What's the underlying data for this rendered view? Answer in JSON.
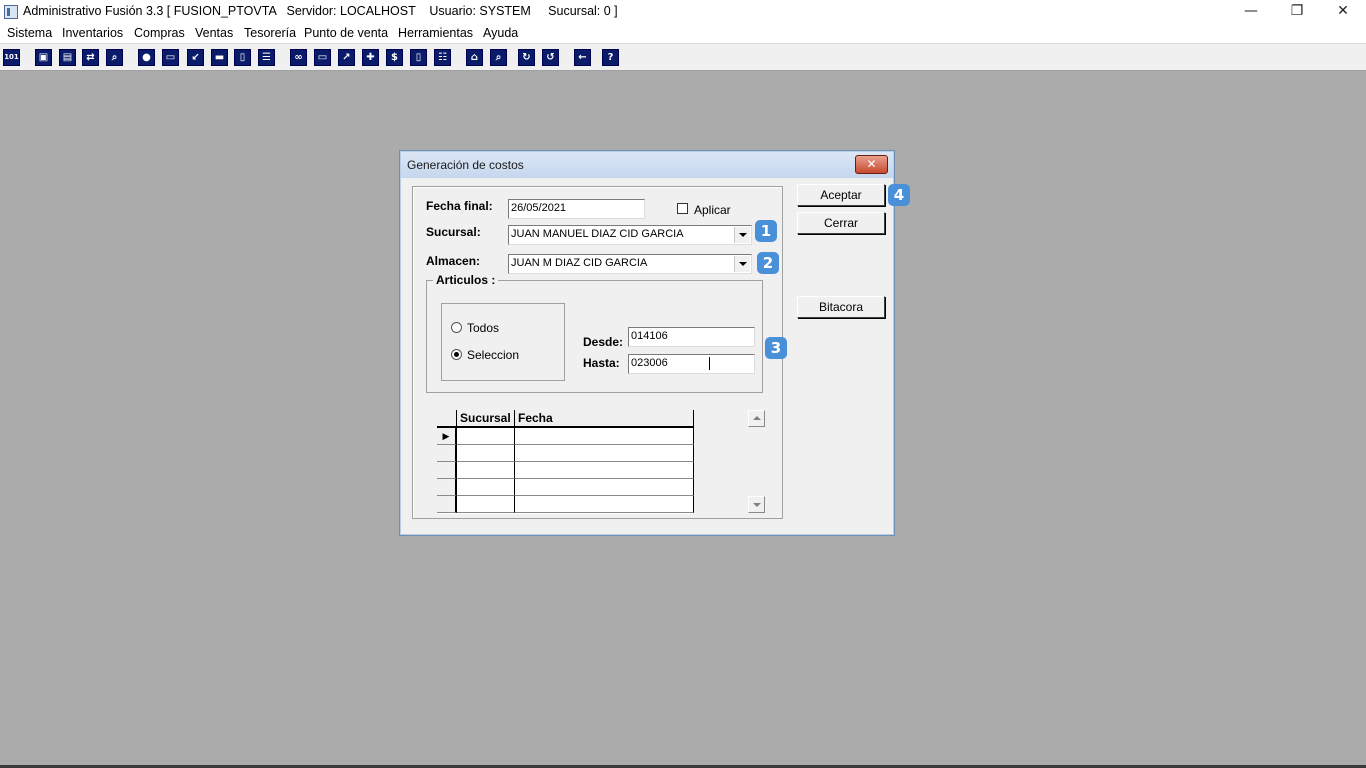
{
  "window": {
    "title": "Administrativo Fusión 3.3 [ FUSION_PTOVTA   Servidor: LOCALHOST    Usuario: SYSTEM     Sucursal: 0 ]",
    "minimize_glyph": "—",
    "restore_glyph": "❐",
    "close_glyph": "✕"
  },
  "menu": [
    "Sistema",
    "Inventarios",
    "Compras",
    "Ventas",
    "Tesorería",
    "Punto de venta",
    "Herramientas",
    "Ayuda"
  ],
  "toolbar": {
    "first_icon_label": "101",
    "help_icon_label": "?",
    "money_icon_label": "$"
  },
  "dialog": {
    "title": "Generación de costos",
    "close_glyph": "✕",
    "fecha_final_label": "Fecha final:",
    "fecha_final_value": "26/05/2021",
    "aplicar_label": "Aplicar",
    "aplicar_checked": false,
    "sucursal_label": "Sucursal:",
    "sucursal_value": "JUAN MANUEL DIAZ CID GARCIA",
    "almacen_label": "Almacen:",
    "almacen_value": "JUAN M DIAZ CID GARCIA",
    "articulos_label": "Articulos :",
    "radio_todos": "Todos",
    "radio_seleccion": "Seleccion",
    "selected_radio": "Seleccion",
    "desde_label": "Desde:",
    "desde_value": "014106",
    "hasta_label": "Hasta:",
    "hasta_value": "023006",
    "grid_columns": [
      "Sucursal",
      "Fecha"
    ],
    "row_indicator": "▶",
    "buttons": {
      "aceptar": "Aceptar",
      "cerrar": "Cerrar",
      "bitacora": "Bitacora"
    },
    "badges": [
      "1",
      "2",
      "3",
      "4"
    ],
    "badge_color": "#4a90d9"
  }
}
